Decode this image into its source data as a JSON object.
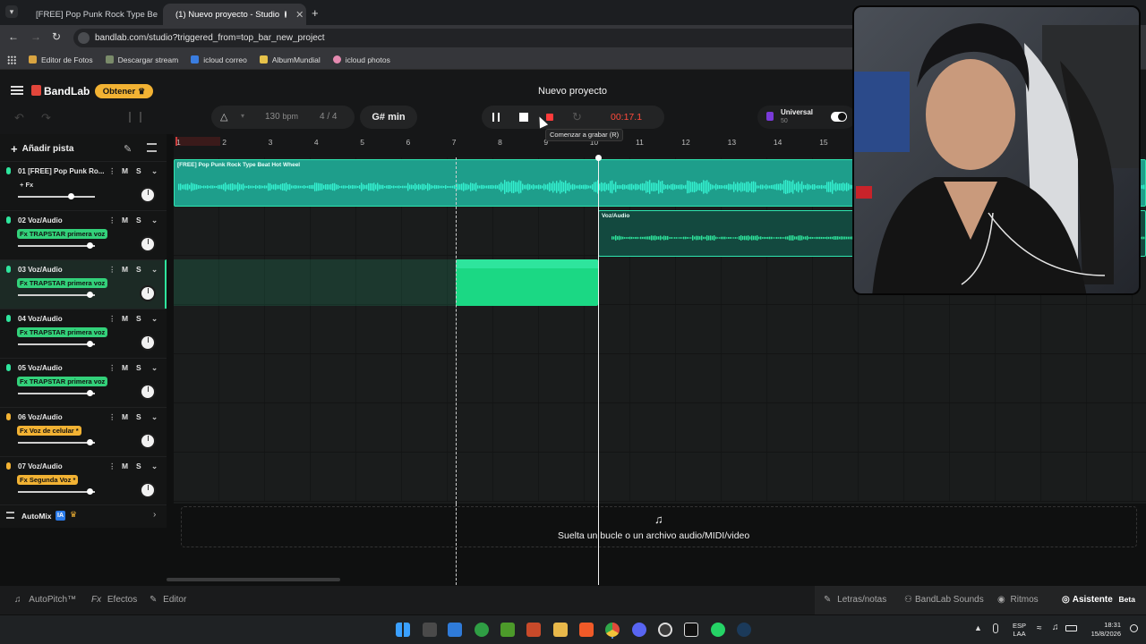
{
  "browser": {
    "tabs": [
      {
        "title": "[FREE] Pop Punk Rock Type Be",
        "icon": "youtube-icon",
        "active": false
      },
      {
        "title": "(1) Nuevo proyecto - Studio",
        "icon": "bandlab-icon",
        "active": true
      }
    ],
    "url": "bandlab.com/studio?triggered_from=top_bar_new_project",
    "bookmarks": [
      "Editor de Fotos",
      "Descargar stream",
      "icloud correo",
      "AlbumMundial",
      "icloud photos"
    ]
  },
  "app": {
    "logo": "BandLab",
    "get_button": "Obtener",
    "project_title": "Nuevo proyecto",
    "bpm_value": "130",
    "bpm_unit": "bpm",
    "time_sig": "4 / 4",
    "key": "G# min",
    "time_display": "00:17.1",
    "record_tooltip": "Comenzar a grabar (R)",
    "preset_name": "Universal",
    "preset_value": "50",
    "add_track": "Añadir pista",
    "automix": "AutoMix",
    "automix_badge": "IA"
  },
  "ruler": [
    "1",
    "2",
    "3",
    "4",
    "5",
    "6",
    "7",
    "8",
    "9",
    "10",
    "11",
    "12",
    "13",
    "14",
    "15"
  ],
  "tracks": [
    {
      "name": "01  [FREE] Pop Punk Ro...",
      "fx": "+ Fx",
      "fx_color": "none",
      "mic_color": "#2ee59d",
      "vol": 0.72
    },
    {
      "name": "02  Voz/Audio",
      "fx": "Fx TRAPSTAR primera voz",
      "fx_color": "#33d17a",
      "mic_color": "#2ee59d",
      "vol": 0.98
    },
    {
      "name": "03  Voz/Audio",
      "fx": "Fx TRAPSTAR primera voz",
      "fx_color": "#33d17a",
      "mic_color": "#2ee59d",
      "vol": 0.98
    },
    {
      "name": "04  Voz/Audio",
      "fx": "Fx TRAPSTAR primera voz",
      "fx_color": "#33d17a",
      "mic_color": "#2ee59d",
      "vol": 0.98
    },
    {
      "name": "05  Voz/Audio",
      "fx": "Fx TRAPSTAR primera voz",
      "fx_color": "#33d17a",
      "mic_color": "#2ee59d",
      "vol": 0.98
    },
    {
      "name": "06  Voz/Audio",
      "fx": "Fx Voz de celular *",
      "fx_color": "#f2b233",
      "mic_color": "#f2b233",
      "vol": 0.98
    },
    {
      "name": "07  Voz/Audio",
      "fx": "Fx Segunda Voz *",
      "fx_color": "#f2b233",
      "mic_color": "#f2b233",
      "vol": 0.98
    }
  ],
  "regions": {
    "beat_title": "[FREE] Pop Punk Rock Type Beat Hot Wheel",
    "vocal_title": "Voz/Audio"
  },
  "dropzone_text": "Suelta un bucle o un archivo audio/MIDI/video",
  "bottom": {
    "autopitch": "AutoPitch™",
    "effects": "Efectos",
    "editor": "Editor",
    "lyrics": "Letras/notas",
    "sounds": "BandLab Sounds",
    "rhythms": "Ritmos",
    "assistant": "Asistente",
    "beta": "Beta"
  },
  "taskbar": {
    "lang": "ESP",
    "lang2": "LAA",
    "time": "18:31",
    "date": "15/8/2026"
  },
  "colors": {
    "accent": "#2ee5b0",
    "record": "#ff3b3b",
    "orange": "#f2b233"
  }
}
